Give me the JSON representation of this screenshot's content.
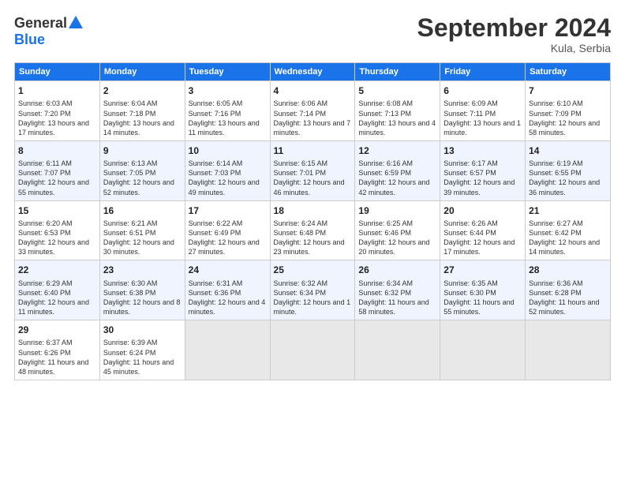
{
  "header": {
    "logo_general": "General",
    "logo_blue": "Blue",
    "month_title": "September 2024",
    "location": "Kula, Serbia"
  },
  "days_of_week": [
    "Sunday",
    "Monday",
    "Tuesday",
    "Wednesday",
    "Thursday",
    "Friday",
    "Saturday"
  ],
  "weeks": [
    [
      {
        "day": 1,
        "sunrise": "6:03 AM",
        "sunset": "7:20 PM",
        "daylight": "13 hours and 17 minutes."
      },
      {
        "day": 2,
        "sunrise": "6:04 AM",
        "sunset": "7:18 PM",
        "daylight": "13 hours and 14 minutes."
      },
      {
        "day": 3,
        "sunrise": "6:05 AM",
        "sunset": "7:16 PM",
        "daylight": "13 hours and 11 minutes."
      },
      {
        "day": 4,
        "sunrise": "6:06 AM",
        "sunset": "7:14 PM",
        "daylight": "13 hours and 7 minutes."
      },
      {
        "day": 5,
        "sunrise": "6:08 AM",
        "sunset": "7:13 PM",
        "daylight": "13 hours and 4 minutes."
      },
      {
        "day": 6,
        "sunrise": "6:09 AM",
        "sunset": "7:11 PM",
        "daylight": "13 hours and 1 minute."
      },
      {
        "day": 7,
        "sunrise": "6:10 AM",
        "sunset": "7:09 PM",
        "daylight": "12 hours and 58 minutes."
      }
    ],
    [
      {
        "day": 8,
        "sunrise": "6:11 AM",
        "sunset": "7:07 PM",
        "daylight": "12 hours and 55 minutes."
      },
      {
        "day": 9,
        "sunrise": "6:13 AM",
        "sunset": "7:05 PM",
        "daylight": "12 hours and 52 minutes."
      },
      {
        "day": 10,
        "sunrise": "6:14 AM",
        "sunset": "7:03 PM",
        "daylight": "12 hours and 49 minutes."
      },
      {
        "day": 11,
        "sunrise": "6:15 AM",
        "sunset": "7:01 PM",
        "daylight": "12 hours and 46 minutes."
      },
      {
        "day": 12,
        "sunrise": "6:16 AM",
        "sunset": "6:59 PM",
        "daylight": "12 hours and 42 minutes."
      },
      {
        "day": 13,
        "sunrise": "6:17 AM",
        "sunset": "6:57 PM",
        "daylight": "12 hours and 39 minutes."
      },
      {
        "day": 14,
        "sunrise": "6:19 AM",
        "sunset": "6:55 PM",
        "daylight": "12 hours and 36 minutes."
      }
    ],
    [
      {
        "day": 15,
        "sunrise": "6:20 AM",
        "sunset": "6:53 PM",
        "daylight": "12 hours and 33 minutes."
      },
      {
        "day": 16,
        "sunrise": "6:21 AM",
        "sunset": "6:51 PM",
        "daylight": "12 hours and 30 minutes."
      },
      {
        "day": 17,
        "sunrise": "6:22 AM",
        "sunset": "6:49 PM",
        "daylight": "12 hours and 27 minutes."
      },
      {
        "day": 18,
        "sunrise": "6:24 AM",
        "sunset": "6:48 PM",
        "daylight": "12 hours and 23 minutes."
      },
      {
        "day": 19,
        "sunrise": "6:25 AM",
        "sunset": "6:46 PM",
        "daylight": "12 hours and 20 minutes."
      },
      {
        "day": 20,
        "sunrise": "6:26 AM",
        "sunset": "6:44 PM",
        "daylight": "12 hours and 17 minutes."
      },
      {
        "day": 21,
        "sunrise": "6:27 AM",
        "sunset": "6:42 PM",
        "daylight": "12 hours and 14 minutes."
      }
    ],
    [
      {
        "day": 22,
        "sunrise": "6:29 AM",
        "sunset": "6:40 PM",
        "daylight": "12 hours and 11 minutes."
      },
      {
        "day": 23,
        "sunrise": "6:30 AM",
        "sunset": "6:38 PM",
        "daylight": "12 hours and 8 minutes."
      },
      {
        "day": 24,
        "sunrise": "6:31 AM",
        "sunset": "6:36 PM",
        "daylight": "12 hours and 4 minutes."
      },
      {
        "day": 25,
        "sunrise": "6:32 AM",
        "sunset": "6:34 PM",
        "daylight": "12 hours and 1 minute."
      },
      {
        "day": 26,
        "sunrise": "6:34 AM",
        "sunset": "6:32 PM",
        "daylight": "11 hours and 58 minutes."
      },
      {
        "day": 27,
        "sunrise": "6:35 AM",
        "sunset": "6:30 PM",
        "daylight": "11 hours and 55 minutes."
      },
      {
        "day": 28,
        "sunrise": "6:36 AM",
        "sunset": "6:28 PM",
        "daylight": "11 hours and 52 minutes."
      }
    ],
    [
      {
        "day": 29,
        "sunrise": "6:37 AM",
        "sunset": "6:26 PM",
        "daylight": "11 hours and 48 minutes."
      },
      {
        "day": 30,
        "sunrise": "6:39 AM",
        "sunset": "6:24 PM",
        "daylight": "11 hours and 45 minutes."
      },
      null,
      null,
      null,
      null,
      null
    ]
  ]
}
